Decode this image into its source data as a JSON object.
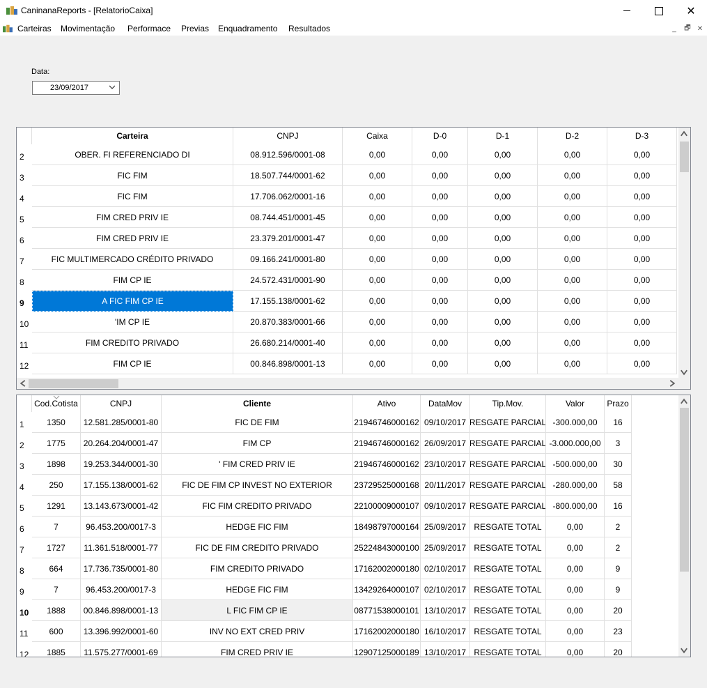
{
  "window": {
    "title": "CaninanaReports - [RelatorioCaixa]"
  },
  "menu": {
    "items": [
      "Carteiras",
      "Movimentação",
      "Performace",
      "Previas",
      "Enquadramento",
      "Resultados"
    ]
  },
  "date": {
    "label": "Data:",
    "value": "23/09/2017"
  },
  "grid1": {
    "columns": [
      "Carteira",
      "CNPJ",
      "Caixa",
      "D-0",
      "D-1",
      "D-2",
      "D-3"
    ],
    "selected_row": 9,
    "rows": [
      {
        "n": "2",
        "carteira": "OBER.        FI REFERENCIADO DI",
        "cnpj": "08.912.596/0001-08",
        "caixa": "0,00",
        "d0": "0,00",
        "d1": "0,00",
        "d2": "0,00",
        "d3": "0,00"
      },
      {
        "n": "3",
        "carteira": "FIC FIM",
        "cnpj": "18.507.744/0001-62",
        "caixa": "0,00",
        "d0": "0,00",
        "d1": "0,00",
        "d2": "0,00",
        "d3": "0,00"
      },
      {
        "n": "4",
        "carteira": "FIC FIM",
        "cnpj": "17.706.062/0001-16",
        "caixa": "0,00",
        "d0": "0,00",
        "d1": "0,00",
        "d2": "0,00",
        "d3": "0,00"
      },
      {
        "n": "5",
        "carteira": "FIM CRED PRIV IE",
        "cnpj": "08.744.451/0001-45",
        "caixa": "0,00",
        "d0": "0,00",
        "d1": "0,00",
        "d2": "0,00",
        "d3": "0,00"
      },
      {
        "n": "6",
        "carteira": "FIM CRED PRIV IE",
        "cnpj": "23.379.201/0001-47",
        "caixa": "0,00",
        "d0": "0,00",
        "d1": "0,00",
        "d2": "0,00",
        "d3": "0,00"
      },
      {
        "n": "7",
        "carteira": "FIC MULTIMERCADO CRÉDITO PRIVADO",
        "cnpj": "09.166.241/0001-80",
        "caixa": "0,00",
        "d0": "0,00",
        "d1": "0,00",
        "d2": "0,00",
        "d3": "0,00"
      },
      {
        "n": "8",
        "carteira": "FIM CP IE",
        "cnpj": "24.572.431/0001-90",
        "caixa": "0,00",
        "d0": "0,00",
        "d1": "0,00",
        "d2": "0,00",
        "d3": "0,00"
      },
      {
        "n": "9",
        "carteira": "A FIC FIM CP IE",
        "cnpj": "17.155.138/0001-62",
        "caixa": "0,00",
        "d0": "0,00",
        "d1": "0,00",
        "d2": "0,00",
        "d3": "0,00"
      },
      {
        "n": "10",
        "carteira": "'IM CP IE",
        "cnpj": "20.870.383/0001-66",
        "caixa": "0,00",
        "d0": "0,00",
        "d1": "0,00",
        "d2": "0,00",
        "d3": "0,00"
      },
      {
        "n": "11",
        "carteira": "FIM CREDITO PRIVADO",
        "cnpj": "26.680.214/0001-40",
        "caixa": "0,00",
        "d0": "0,00",
        "d1": "0,00",
        "d2": "0,00",
        "d3": "0,00"
      },
      {
        "n": "12",
        "carteira": "FIM CP IE",
        "cnpj": "00.846.898/0001-13",
        "caixa": "0,00",
        "d0": "0,00",
        "d1": "0,00",
        "d2": "0,00",
        "d3": "0,00"
      }
    ]
  },
  "grid2": {
    "columns": [
      "Cod.Cotista",
      "CNPJ",
      "Cliente",
      "Ativo",
      "DataMov",
      "Tip.Mov.",
      "Valor",
      "Prazo"
    ],
    "current_row": 10,
    "rows": [
      {
        "n": "1",
        "cod": "1350",
        "cnpj": "12.581.285/0001-80",
        "cliente": "FIC DE FIM",
        "ativo": "21946746000162",
        "data": "09/10/2017",
        "tipo": "RESGATE PARCIAL",
        "valor": "-300.000,00",
        "prazo": "16"
      },
      {
        "n": "2",
        "cod": "1775",
        "cnpj": "20.264.204/0001-47",
        "cliente": "FIM CP",
        "ativo": "21946746000162",
        "data": "26/09/2017",
        "tipo": "RESGATE PARCIAL",
        "valor": "-3.000.000,00",
        "prazo": "3"
      },
      {
        "n": "3",
        "cod": "1898",
        "cnpj": "19.253.344/0001-30",
        "cliente": "' FIM CRED PRIV IE",
        "ativo": "21946746000162",
        "data": "23/10/2017",
        "tipo": "RESGATE PARCIAL",
        "valor": "-500.000,00",
        "prazo": "30"
      },
      {
        "n": "4",
        "cod": "250",
        "cnpj": "17.155.138/0001-62",
        "cliente": "FIC DE FIM CP INVEST NO EXTERIOR",
        "ativo": "23729525000168",
        "data": "20/11/2017",
        "tipo": "RESGATE PARCIAL",
        "valor": "-280.000,00",
        "prazo": "58"
      },
      {
        "n": "5",
        "cod": "1291",
        "cnpj": "13.143.673/0001-42",
        "cliente": "FIC FIM CREDITO PRIVADO",
        "ativo": "22100009000107",
        "data": "09/10/2017",
        "tipo": "RESGATE PARCIAL",
        "valor": "-800.000,00",
        "prazo": "16"
      },
      {
        "n": "6",
        "cod": "7",
        "cnpj": "96.453.200/0017-3",
        "cliente": "HEDGE FIC FIM",
        "ativo": "18498797000164",
        "data": "25/09/2017",
        "tipo": "RESGATE TOTAL",
        "valor": "0,00",
        "prazo": "2"
      },
      {
        "n": "7",
        "cod": "1727",
        "cnpj": "11.361.518/0001-77",
        "cliente": "FIC DE FIM CREDITO PRIVADO",
        "ativo": "25224843000100",
        "data": "25/09/2017",
        "tipo": "RESGATE TOTAL",
        "valor": "0,00",
        "prazo": "2"
      },
      {
        "n": "8",
        "cod": "664",
        "cnpj": "17.736.735/0001-80",
        "cliente": "FIM CREDITO PRIVADO",
        "ativo": "17162002000180",
        "data": "02/10/2017",
        "tipo": "RESGATE TOTAL",
        "valor": "0,00",
        "prazo": "9"
      },
      {
        "n": "9",
        "cod": "7",
        "cnpj": "96.453.200/0017-3",
        "cliente": "HEDGE FIC FIM",
        "ativo": "13429264000107",
        "data": "02/10/2017",
        "tipo": "RESGATE TOTAL",
        "valor": "0,00",
        "prazo": "9"
      },
      {
        "n": "10",
        "cod": "1888",
        "cnpj": "00.846.898/0001-13",
        "cliente": "L FIC FIM CP IE",
        "ativo": "08771538000101",
        "data": "13/10/2017",
        "tipo": "RESGATE TOTAL",
        "valor": "0,00",
        "prazo": "20"
      },
      {
        "n": "11",
        "cod": "600",
        "cnpj": "13.396.992/0001-60",
        "cliente": "INV NO EXT CRED PRIV",
        "ativo": "17162002000180",
        "data": "16/10/2017",
        "tipo": "RESGATE TOTAL",
        "valor": "0,00",
        "prazo": "23"
      },
      {
        "n": "12",
        "cod": "1885",
        "cnpj": "11.575.277/0001-69",
        "cliente": "FIM CRED PRIV IE",
        "ativo": "12907125000189",
        "data": "13/10/2017",
        "tipo": "RESGATE TOTAL",
        "valor": "0,00",
        "prazo": "20"
      }
    ]
  },
  "colors": {
    "selection": "#0078d7",
    "grid_border": "#828790"
  }
}
